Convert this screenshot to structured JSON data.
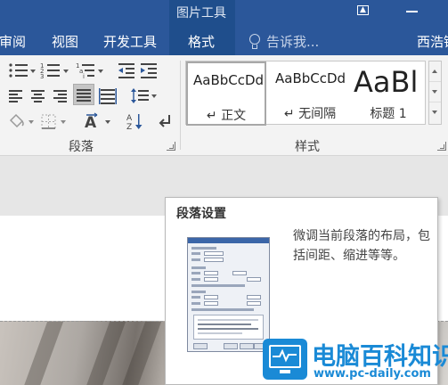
{
  "titlebar": {
    "context_title": "图片工具",
    "colors": {
      "bar": "#2b579a",
      "context": "#1f4e8c"
    }
  },
  "tabs": [
    {
      "label": "审阅"
    },
    {
      "label": "视图"
    },
    {
      "label": "开发工具"
    },
    {
      "label": "格式",
      "active": true
    }
  ],
  "tell_me": {
    "placeholder": "告诉我..."
  },
  "user": {
    "name": "西浩钣"
  },
  "ribbon": {
    "paragraph_group": {
      "label": "段落",
      "icons": [
        "bullets-icon",
        "numbering-icon",
        "multilevel-list-icon",
        "decrease-indent-icon",
        "increase-indent-icon",
        "align-left-icon",
        "align-center-icon",
        "align-right-icon",
        "justify-icon",
        "distributed-icon",
        "line-spacing-icon",
        "shading-icon",
        "borders-icon",
        "asian-layout-icon",
        "sort-icon",
        "show-marks-icon"
      ]
    },
    "styles_group": {
      "label": "样式",
      "cards": [
        {
          "sample": "AaBbCcDd",
          "name": "↵ 正文",
          "selected": true
        },
        {
          "sample": "AaBbCcDd",
          "name": "↵ 无间隔"
        },
        {
          "sample": "AaBl",
          "name": "标题 1"
        }
      ]
    }
  },
  "tooltip": {
    "title": "段落设置",
    "description": "微调当前段落的布局，包括间距、缩进等等。"
  },
  "watermark": {
    "title": "电脑百科知识",
    "url": "www.pc-daily.com",
    "color": "#1a8ad6"
  }
}
